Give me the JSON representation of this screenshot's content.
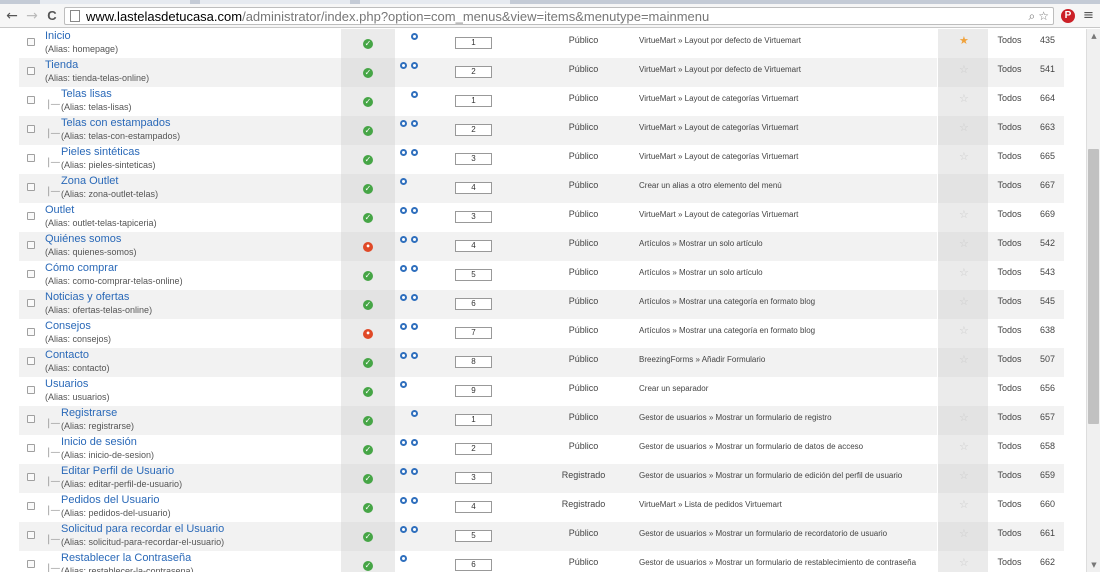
{
  "browser": {
    "url_domain": "www.lastelasdetucasa.com",
    "url_path": "/administrator/index.php?option=com_menus&view=items&menutype=mainmenu",
    "back_icon": "←",
    "forward_icon": "→",
    "reload_icon": "C",
    "zoom_icon": "⌕",
    "bookmark_icon": "☆",
    "extension_icon": "P",
    "menu_icon": "≡"
  },
  "alias_label": "(Alias: ",
  "alias_close": ")",
  "rows": [
    {
      "title": "Inicio",
      "alias": "homepage",
      "depth": 0,
      "status": "published",
      "status_glyph": "✓",
      "dots": [
        false,
        true
      ],
      "order": "1",
      "access": "Público",
      "type": "VirtueMart » Layout por defecto de Virtuemart",
      "default": "on",
      "star_glyph": "★",
      "lang": "Todos",
      "id": "435"
    },
    {
      "title": "Tienda",
      "alias": "tienda-telas-online",
      "depth": 0,
      "status": "published",
      "status_glyph": "✓",
      "dots": [
        true,
        true
      ],
      "order": "2",
      "access": "Público",
      "type": "VirtueMart » Layout por defecto de Virtuemart",
      "default": "off",
      "star_glyph": "☆",
      "lang": "Todos",
      "id": "541"
    },
    {
      "title": "Telas lisas",
      "alias": "telas-lisas",
      "depth": 1,
      "status": "published",
      "status_glyph": "✓",
      "dots": [
        false,
        true
      ],
      "order": "1",
      "access": "Público",
      "type": "VirtueMart » Layout de categorías Virtuemart",
      "default": "off",
      "star_glyph": "☆",
      "lang": "Todos",
      "id": "664"
    },
    {
      "title": "Telas con estampados",
      "alias": "telas-con-estampados",
      "depth": 1,
      "status": "published",
      "status_glyph": "✓",
      "dots": [
        true,
        true
      ],
      "order": "2",
      "access": "Público",
      "type": "VirtueMart » Layout de categorías Virtuemart",
      "default": "off",
      "star_glyph": "☆",
      "lang": "Todos",
      "id": "663"
    },
    {
      "title": "Pieles sintéticas",
      "alias": "pieles-sinteticas",
      "depth": 1,
      "status": "published",
      "status_glyph": "✓",
      "dots": [
        true,
        true
      ],
      "order": "3",
      "access": "Público",
      "type": "VirtueMart » Layout de categorías Virtuemart",
      "default": "off",
      "star_glyph": "☆",
      "lang": "Todos",
      "id": "665"
    },
    {
      "title": "Zona Outlet",
      "alias": "zona-outlet-telas",
      "depth": 1,
      "status": "published",
      "status_glyph": "✓",
      "dots": [
        true,
        false
      ],
      "order": "4",
      "access": "Público",
      "type": "Crear un alias a otro elemento del menú",
      "default": "none",
      "star_glyph": "",
      "lang": "Todos",
      "id": "667"
    },
    {
      "title": "Outlet",
      "alias": "outlet-telas-tapiceria",
      "depth": 0,
      "status": "published",
      "status_glyph": "✓",
      "dots": [
        true,
        true
      ],
      "order": "3",
      "access": "Público",
      "type": "VirtueMart » Layout de categorías Virtuemart",
      "default": "off",
      "star_glyph": "☆",
      "lang": "Todos",
      "id": "669"
    },
    {
      "title": "Quiénes somos",
      "alias": "quienes-somos",
      "depth": 0,
      "status": "unpublished",
      "status_glyph": "•",
      "dots": [
        true,
        true
      ],
      "order": "4",
      "access": "Público",
      "type": "Artículos » Mostrar un solo artículo",
      "default": "off",
      "star_glyph": "☆",
      "lang": "Todos",
      "id": "542"
    },
    {
      "title": "Cómo comprar",
      "alias": "como-comprar-telas-online",
      "depth": 0,
      "status": "published",
      "status_glyph": "✓",
      "dots": [
        true,
        true
      ],
      "order": "5",
      "access": "Público",
      "type": "Artículos » Mostrar un solo artículo",
      "default": "off",
      "star_glyph": "☆",
      "lang": "Todos",
      "id": "543"
    },
    {
      "title": "Noticias y ofertas",
      "alias": "ofertas-telas-online",
      "depth": 0,
      "status": "published",
      "status_glyph": "✓",
      "dots": [
        true,
        true
      ],
      "order": "6",
      "access": "Público",
      "type": "Artículos » Mostrar una categoría en formato blog",
      "default": "off",
      "star_glyph": "☆",
      "lang": "Todos",
      "id": "545"
    },
    {
      "title": "Consejos",
      "alias": "consejos",
      "depth": 0,
      "status": "unpublished",
      "status_glyph": "•",
      "dots": [
        true,
        true
      ],
      "order": "7",
      "access": "Público",
      "type": "Artículos » Mostrar una categoría en formato blog",
      "default": "off",
      "star_glyph": "☆",
      "lang": "Todos",
      "id": "638"
    },
    {
      "title": "Contacto",
      "alias": "contacto",
      "depth": 0,
      "status": "published",
      "status_glyph": "✓",
      "dots": [
        true,
        true
      ],
      "order": "8",
      "access": "Público",
      "type": "BreezingForms » Añadir Formulario",
      "default": "off",
      "star_glyph": "☆",
      "lang": "Todos",
      "id": "507"
    },
    {
      "title": "Usuarios",
      "alias": "usuarios",
      "depth": 0,
      "status": "published",
      "status_glyph": "✓",
      "dots": [
        true,
        false
      ],
      "order": "9",
      "access": "Público",
      "type": "Crear un separador",
      "default": "none",
      "star_glyph": "",
      "lang": "Todos",
      "id": "656"
    },
    {
      "title": "Registrarse",
      "alias": "registrarse",
      "depth": 1,
      "status": "published",
      "status_glyph": "✓",
      "dots": [
        false,
        true
      ],
      "order": "1",
      "access": "Público",
      "type": "Gestor de usuarios » Mostrar un formulario de registro",
      "default": "off",
      "star_glyph": "☆",
      "lang": "Todos",
      "id": "657"
    },
    {
      "title": "Inicio de sesión",
      "alias": "inicio-de-sesion",
      "depth": 1,
      "status": "published",
      "status_glyph": "✓",
      "dots": [
        true,
        true
      ],
      "order": "2",
      "access": "Público",
      "type": "Gestor de usuarios » Mostrar un formulario de datos de acceso",
      "default": "off",
      "star_glyph": "☆",
      "lang": "Todos",
      "id": "658"
    },
    {
      "title": "Editar Perfil de Usuario",
      "alias": "editar-perfil-de-usuario",
      "depth": 1,
      "status": "published",
      "status_glyph": "✓",
      "dots": [
        true,
        true
      ],
      "order": "3",
      "access": "Registrado",
      "type": "Gestor de usuarios » Mostrar un formulario de edición del perfil de usuario",
      "default": "off",
      "star_glyph": "☆",
      "lang": "Todos",
      "id": "659"
    },
    {
      "title": "Pedidos del Usuario",
      "alias": "pedidos-del-usuario",
      "depth": 1,
      "status": "published",
      "status_glyph": "✓",
      "dots": [
        true,
        true
      ],
      "order": "4",
      "access": "Registrado",
      "type": "VirtueMart » Lista de pedidos Virtuemart",
      "default": "off",
      "star_glyph": "☆",
      "lang": "Todos",
      "id": "660"
    },
    {
      "title": "Solicitud para recordar el Usuario",
      "alias": "solicitud-para-recordar-el-usuario",
      "depth": 1,
      "status": "published",
      "status_glyph": "✓",
      "dots": [
        true,
        true
      ],
      "order": "5",
      "access": "Público",
      "type": "Gestor de usuarios » Mostrar un formulario de recordatorio de usuario",
      "default": "off",
      "star_glyph": "☆",
      "lang": "Todos",
      "id": "661"
    },
    {
      "title": "Restablecer la Contraseña",
      "alias": "restablecer-la-contrasena",
      "depth": 1,
      "status": "published",
      "status_glyph": "✓",
      "dots": [
        true,
        false
      ],
      "order": "6",
      "access": "Público",
      "type": "Gestor de usuarios » Mostrar un formulario de restablecimiento de contraseña",
      "default": "off",
      "star_glyph": "☆",
      "lang": "Todos",
      "id": "662"
    }
  ],
  "tree_glyph": "|—",
  "scroll": {
    "up_glyph": "▲",
    "down_glyph": "▼"
  },
  "colors": {
    "link": "#2a69b8",
    "published": "#46a546",
    "unpublished": "#e04927",
    "star_default": "#f0a23b",
    "home_dot": "#2f6fbd"
  }
}
